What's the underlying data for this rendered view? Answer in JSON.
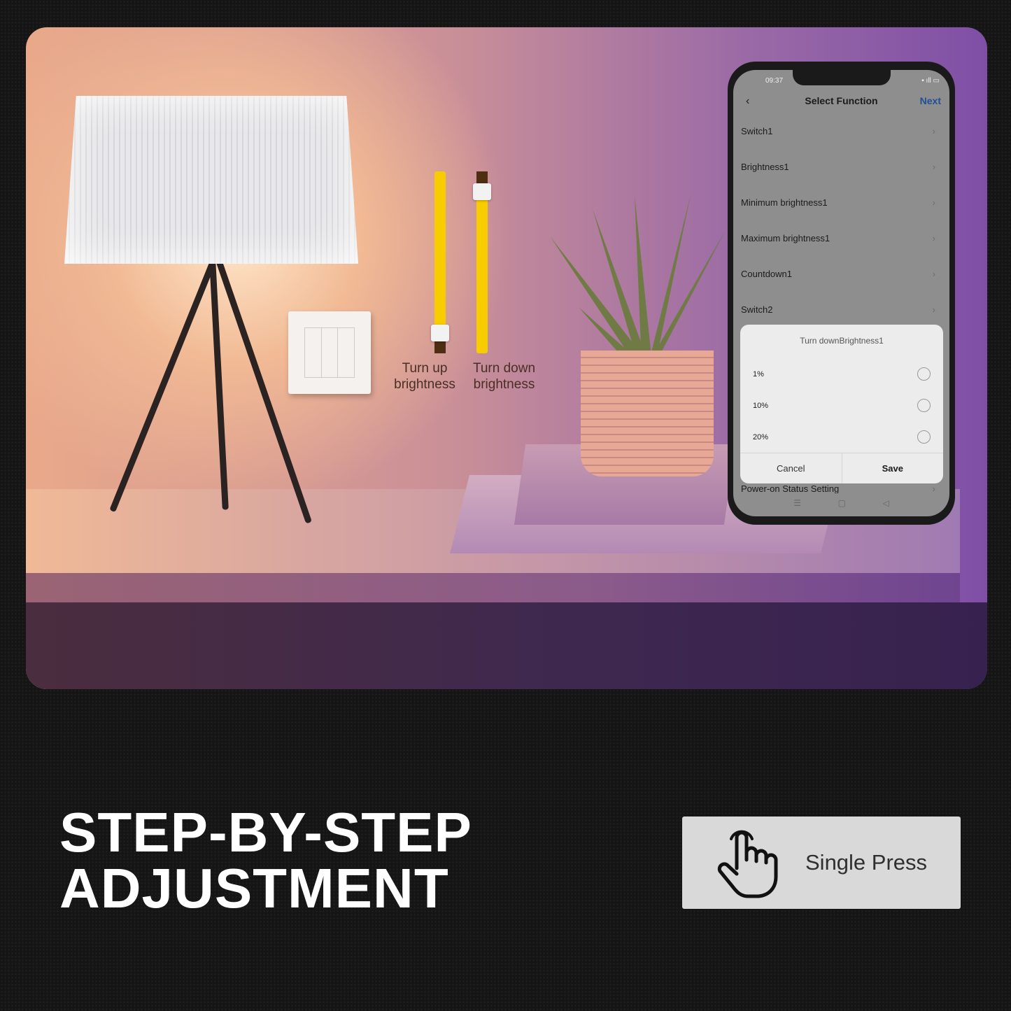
{
  "scene": {
    "slider_up_label": [
      "Turn up",
      "brightness"
    ],
    "slider_down_label": [
      "Turn down",
      "brightness"
    ],
    "slider_up_level_percent": 12,
    "slider_down_level_percent": 88,
    "slider_color": "#f7cd00"
  },
  "phone": {
    "time": "09:37",
    "title": "Select Function",
    "back_icon": "chevron-left-icon",
    "next_label": "Next",
    "accent": "#1f4f9a",
    "items": [
      "Switch1",
      "Brightness1",
      "Minimum brightness1",
      "Maximum brightness1",
      "Countdown1",
      "Switch2"
    ],
    "bottom_item": "Power-on Status Setting",
    "dialog": {
      "title": "Turn downBrightness1",
      "options": [
        "1%",
        "10%",
        "20%"
      ],
      "cancel": "Cancel",
      "save": "Save"
    }
  },
  "headline": [
    "STEP-BY-STEP",
    "ADJUSTMENT"
  ],
  "press_button": {
    "label": "Single Press",
    "icon": "hand-pointer-icon"
  }
}
